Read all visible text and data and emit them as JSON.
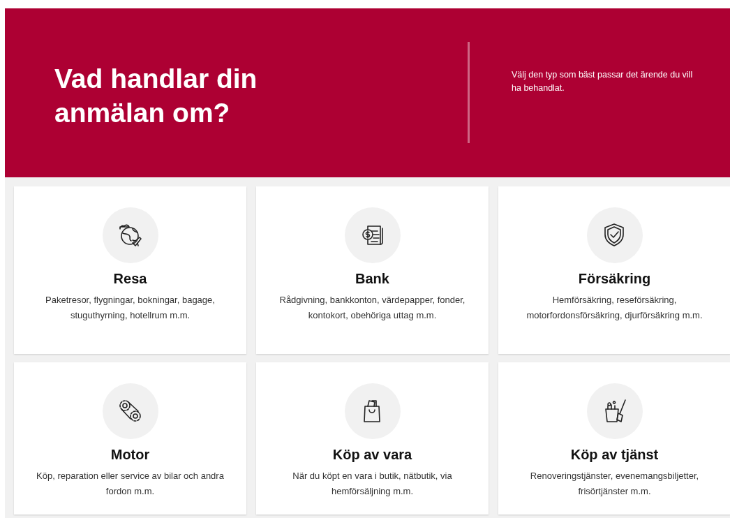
{
  "header": {
    "title": "Vad handlar din anmälan om?",
    "intro": "Välj den typ som bäst passar det ärende du vill ha behandlat."
  },
  "categories": [
    {
      "title": "Resa",
      "description": "Paketresor, flygningar, bokningar, bagage, stuguthyrning, hotellrum m.m."
    },
    {
      "title": "Bank",
      "description": "Rådgivning, bankkonton, värdepapper, fonder, kontokort, obehöriga uttag m.m."
    },
    {
      "title": "Försäkring",
      "description": "Hemförsäkring, reseförsäkring, motorfordonsförsäkring, djurförsäkring m.m."
    },
    {
      "title": "Motor",
      "description": "Köp, reparation eller service av bilar och andra fordon m.m."
    },
    {
      "title": "Köp av vara",
      "description": "När du köpt en vara i butik, nätbutik, via hemförsäljning m.m."
    },
    {
      "title": "Köp av tjänst",
      "description": "Renoveringstjänster, evenemangsbiljetter, frisörtjänster m.m."
    }
  ]
}
